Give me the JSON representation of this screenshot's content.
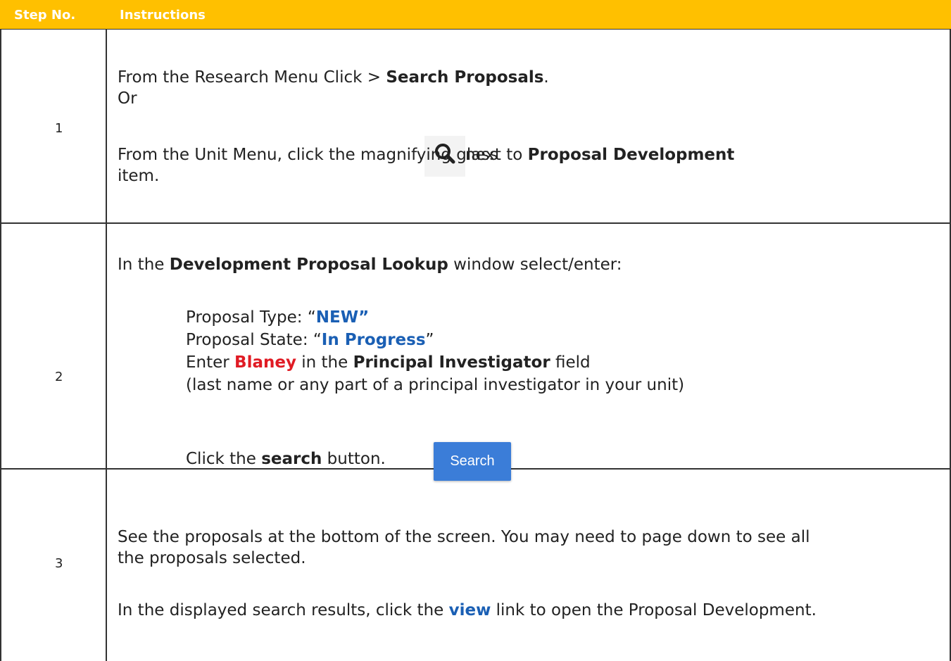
{
  "header": {
    "step_no": "Step No.",
    "instructions": "Instructions"
  },
  "steps": [
    {
      "num": "1",
      "line1_a": "From the Research Menu Click > ",
      "line1_b": "Search Proposals",
      "line1_c": ".",
      "line2": "Or",
      "line3_a": "From the Unit Menu, click the magnifying glass ",
      "line3_b": " next to ",
      "line3_c": "Proposal Development",
      "line4": "item.",
      "icon": "magnifying-glass-icon"
    },
    {
      "num": "2",
      "intro_a": "In the ",
      "intro_b": "Development Proposal Lookup",
      "intro_c": " window select/enter:",
      "type_label": "Proposal Type: “",
      "type_value": "NEW”",
      "state_label": "Proposal State: “",
      "state_value": "In Progress",
      "state_close": "”",
      "pi_a": "Enter ",
      "pi_name": "Blaney",
      "pi_b": " in the ",
      "pi_field": "Principal Investigator",
      "pi_c": " field",
      "pi_note": "(last name or any part of a principal investigator in your unit)",
      "click_a": "Click the ",
      "click_b": "search",
      "click_c": " button.",
      "button_label": "Search"
    },
    {
      "num": "3",
      "line1": "See the proposals at the bottom of the screen.  You may need to page down to see all",
      "line2": "the proposals selected.",
      "line3_a": "In the displayed search results, click the ",
      "line3_b": "view",
      "line3_c": " link to open the Proposal Development."
    }
  ],
  "colors": {
    "header_bg": "#FFC000",
    "link_blue": "#1a5fb4",
    "red": "#e01b24",
    "button_blue": "#3b7dd8"
  }
}
